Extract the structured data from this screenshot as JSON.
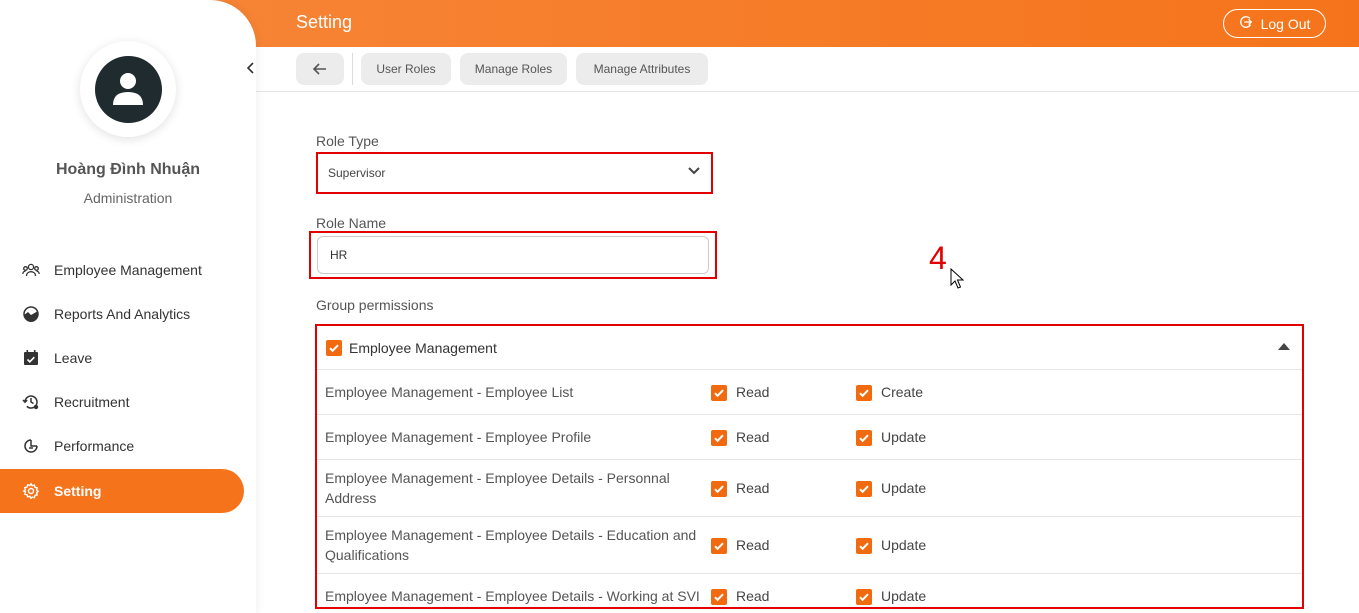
{
  "header": {
    "title": "Setting",
    "logout_label": "Log Out"
  },
  "user": {
    "name": "Hoàng Đình Nhuận",
    "role": "Administration"
  },
  "nav": [
    {
      "label": "Employee Management",
      "icon": "users-icon"
    },
    {
      "label": "Reports And Analytics",
      "icon": "chart-icon"
    },
    {
      "label": "Leave",
      "icon": "calendar-icon"
    },
    {
      "label": "Recruitment",
      "icon": "history-icon"
    },
    {
      "label": "Performance",
      "icon": "performance-icon"
    },
    {
      "label": "Setting",
      "icon": "gear-icon",
      "active": true
    }
  ],
  "tabs": [
    "User Roles",
    "Manage Roles",
    "Manage Attributes"
  ],
  "form": {
    "role_type_label": "Role Type",
    "role_type_value": "Supervisor",
    "role_name_label": "Role Name",
    "role_name_value": "HR",
    "group_permissions_label": "Group permissions"
  },
  "annotation": "4",
  "permissions": {
    "group": "Employee Management",
    "group_checked": true,
    "rows": [
      {
        "name": "Employee Management - Employee List",
        "perm1": "Read",
        "perm2": "Create"
      },
      {
        "name": "Employee Management - Employee Profile",
        "perm1": "Read",
        "perm2": "Update"
      },
      {
        "name": "Employee Management - Employee Details - Personnal Address",
        "perm1": "Read",
        "perm2": "Update"
      },
      {
        "name": "Employee Management - Employee Details - Education and Qualifications",
        "perm1": "Read",
        "perm2": "Update"
      },
      {
        "name": "Employee Management - Employee Details - Working at SVI",
        "perm1": "Read",
        "perm2": "Update"
      }
    ]
  },
  "colors": {
    "accent": "#f5741b",
    "highlight": "#e20000",
    "checkbox": "#f26a10"
  }
}
